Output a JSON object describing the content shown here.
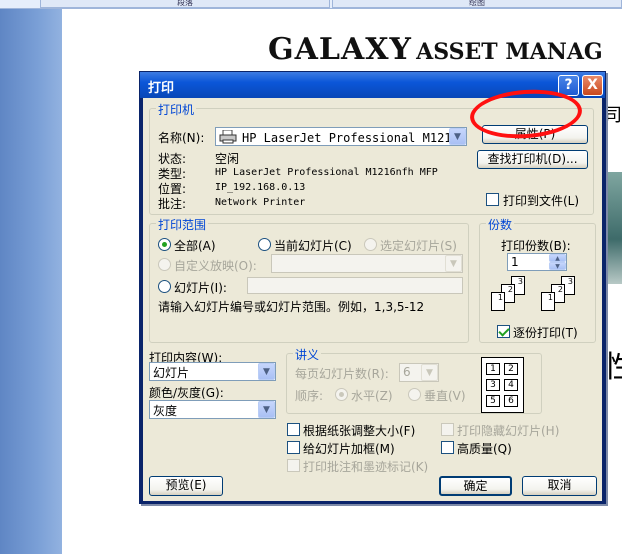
{
  "background": {
    "tabs": [
      "段落",
      "绘图"
    ],
    "slide_title_big": "GALAXY",
    "slide_title_rest": "ASSET MANAG",
    "side_char_1": "司",
    "side_char_2": "性"
  },
  "dialog": {
    "title": "打印",
    "help_label": "?",
    "close_label": "X",
    "printer": {
      "group_label": "打印机",
      "name_label": "名称(N):",
      "name_value": "HP LaserJet Professional M1216n...",
      "properties_button": "属性(P)",
      "find_printer_button": "查找打印机(D)...",
      "status_label": "状态:",
      "status_value": "空闲",
      "type_label": "类型:",
      "type_value": "HP LaserJet Professional M1216nfh MFP",
      "location_label": "位置:",
      "location_value": "IP_192.168.0.13",
      "comment_label": "批注:",
      "comment_value": "Network Printer",
      "print_to_file_label": "打印到文件(L)"
    },
    "range": {
      "group_label": "打印范围",
      "all": "全部(A)",
      "current_slide": "当前幻灯片(C)",
      "selection": "选定幻灯片(S)",
      "custom_show": "自定义放映(O):",
      "slides": "幻灯片(I):",
      "hint": "请输入幻灯片编号或幻灯片范围。例如，1,3,5-12"
    },
    "copies": {
      "group_label": "份数",
      "count_label": "打印份数(B):",
      "count_value": "1",
      "collate_label": "逐份打印(T)"
    },
    "print_what": {
      "label": "打印内容(W):",
      "value": "幻灯片"
    },
    "color": {
      "label": "颜色/灰度(G):",
      "value": "灰度"
    },
    "handouts": {
      "group_label": "讲义",
      "per_page_label": "每页幻灯片数(R):",
      "per_page_value": "6",
      "order_label": "顺序:",
      "horizontal": "水平(Z)",
      "vertical": "垂直(V)",
      "preview_numbers": [
        "1",
        "2",
        "3",
        "4",
        "5",
        "6"
      ]
    },
    "options": {
      "scale_to_fit": "根据纸张调整大小(F)",
      "print_hidden": "打印隐藏幻灯片(H)",
      "frame_slides": "给幻灯片加框(M)",
      "high_quality": "高质量(Q)",
      "print_comments": "打印批注和墨迹标记(K)"
    },
    "buttons": {
      "preview": "预览(E)",
      "ok": "确定",
      "cancel": "取消"
    }
  },
  "colors": {
    "titlebar": "#0b56d8",
    "dialog_face": "#ece9d8",
    "group_label": "#0046d5",
    "annotation": "#ff1010"
  }
}
